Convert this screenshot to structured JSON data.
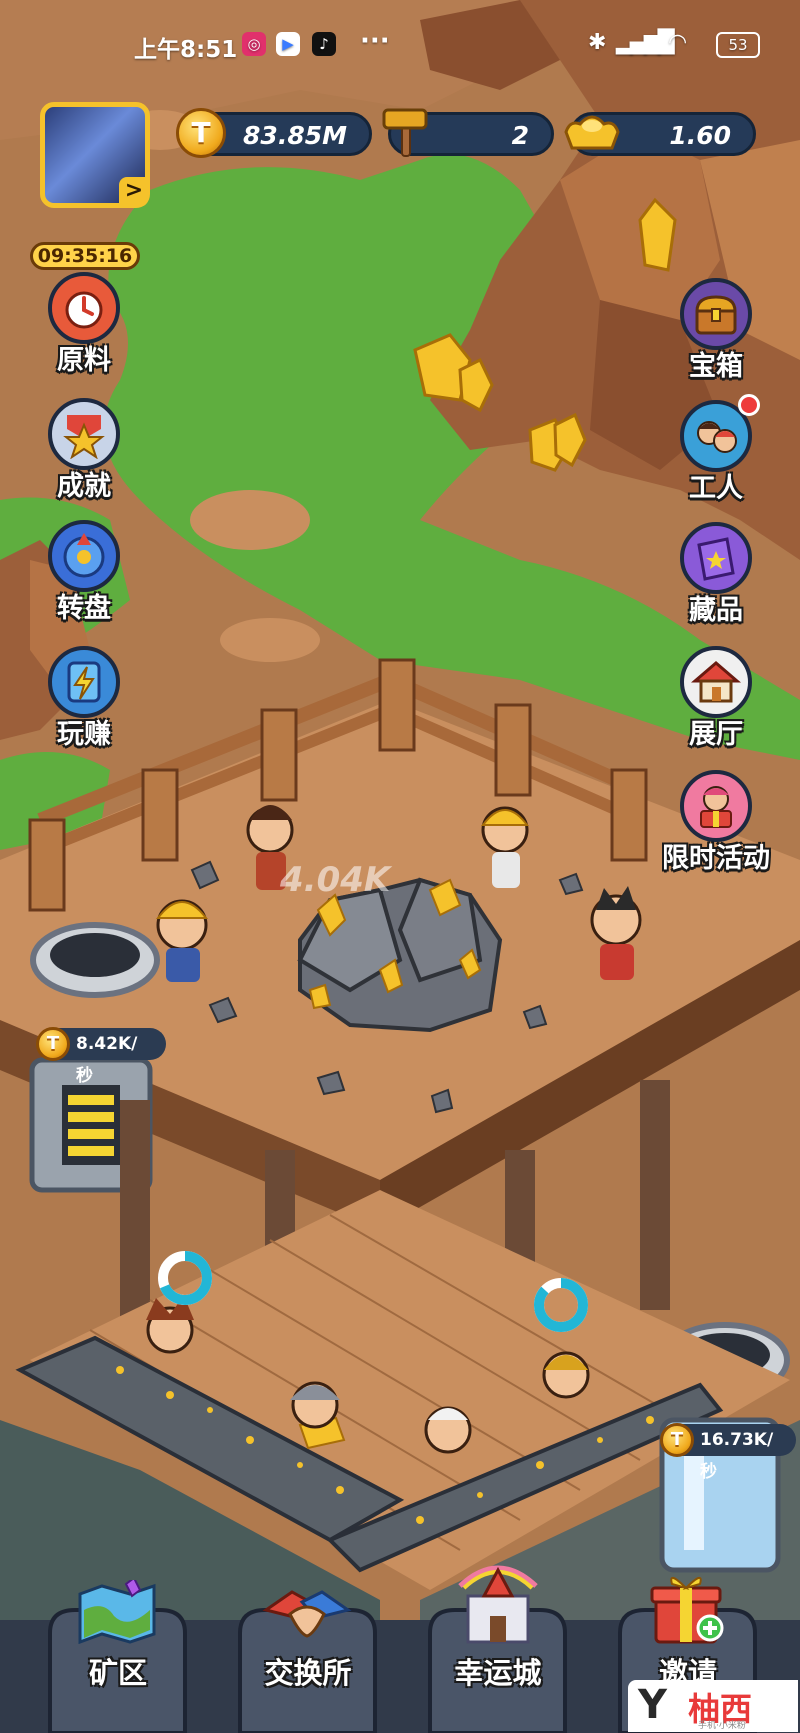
{
  "status_bar": {
    "time": "上午8:51",
    "apps": [
      "instagram-icon",
      "video-app-icon",
      "tiktok-icon"
    ],
    "more": "···",
    "battery": "53"
  },
  "avatar": {
    "arrow": ">"
  },
  "currencies": {
    "coins": "83.85M",
    "hammers": "2",
    "ingots": "1.60"
  },
  "timer": "09:35:16",
  "left_menu": [
    {
      "label": "原料",
      "icon": "alarm-clock-icon"
    },
    {
      "label": "成就",
      "icon": "star-badge-icon"
    },
    {
      "label": "转盘",
      "icon": "wheel-icon"
    },
    {
      "label": "玩赚",
      "icon": "lightning-card-icon"
    }
  ],
  "right_menu": [
    {
      "label": "宝箱",
      "icon": "treasure-chest-icon"
    },
    {
      "label": "工人",
      "icon": "workers-icon",
      "notification": true
    },
    {
      "label": "藏品",
      "icon": "collection-book-icon"
    },
    {
      "label": "展厅",
      "icon": "house-icon"
    },
    {
      "label": "限时活动",
      "icon": "gift-girl-icon"
    }
  ],
  "mine": {
    "rock_floating_value": "4.04K",
    "upper_rate": "8.42K/秒",
    "lower_rate": "16.73K/秒",
    "coin_symbol": "T"
  },
  "bottom_nav": [
    {
      "label": "矿区",
      "icon": "map-icon"
    },
    {
      "label": "交换所",
      "icon": "handshake-icon"
    },
    {
      "label": "幸运城",
      "icon": "castle-icon"
    },
    {
      "label": "邀请",
      "icon": "gift-box-icon"
    }
  ],
  "watermark": {
    "mark": "Y",
    "text": "柚西",
    "sub": "手机·小米粉"
  },
  "colors": {
    "grass": "#5fae3f",
    "dirt": "#c98f5f",
    "cliff": "#9c5f3a",
    "bar_bg": "#253a58",
    "gold": "#f5b81e"
  }
}
